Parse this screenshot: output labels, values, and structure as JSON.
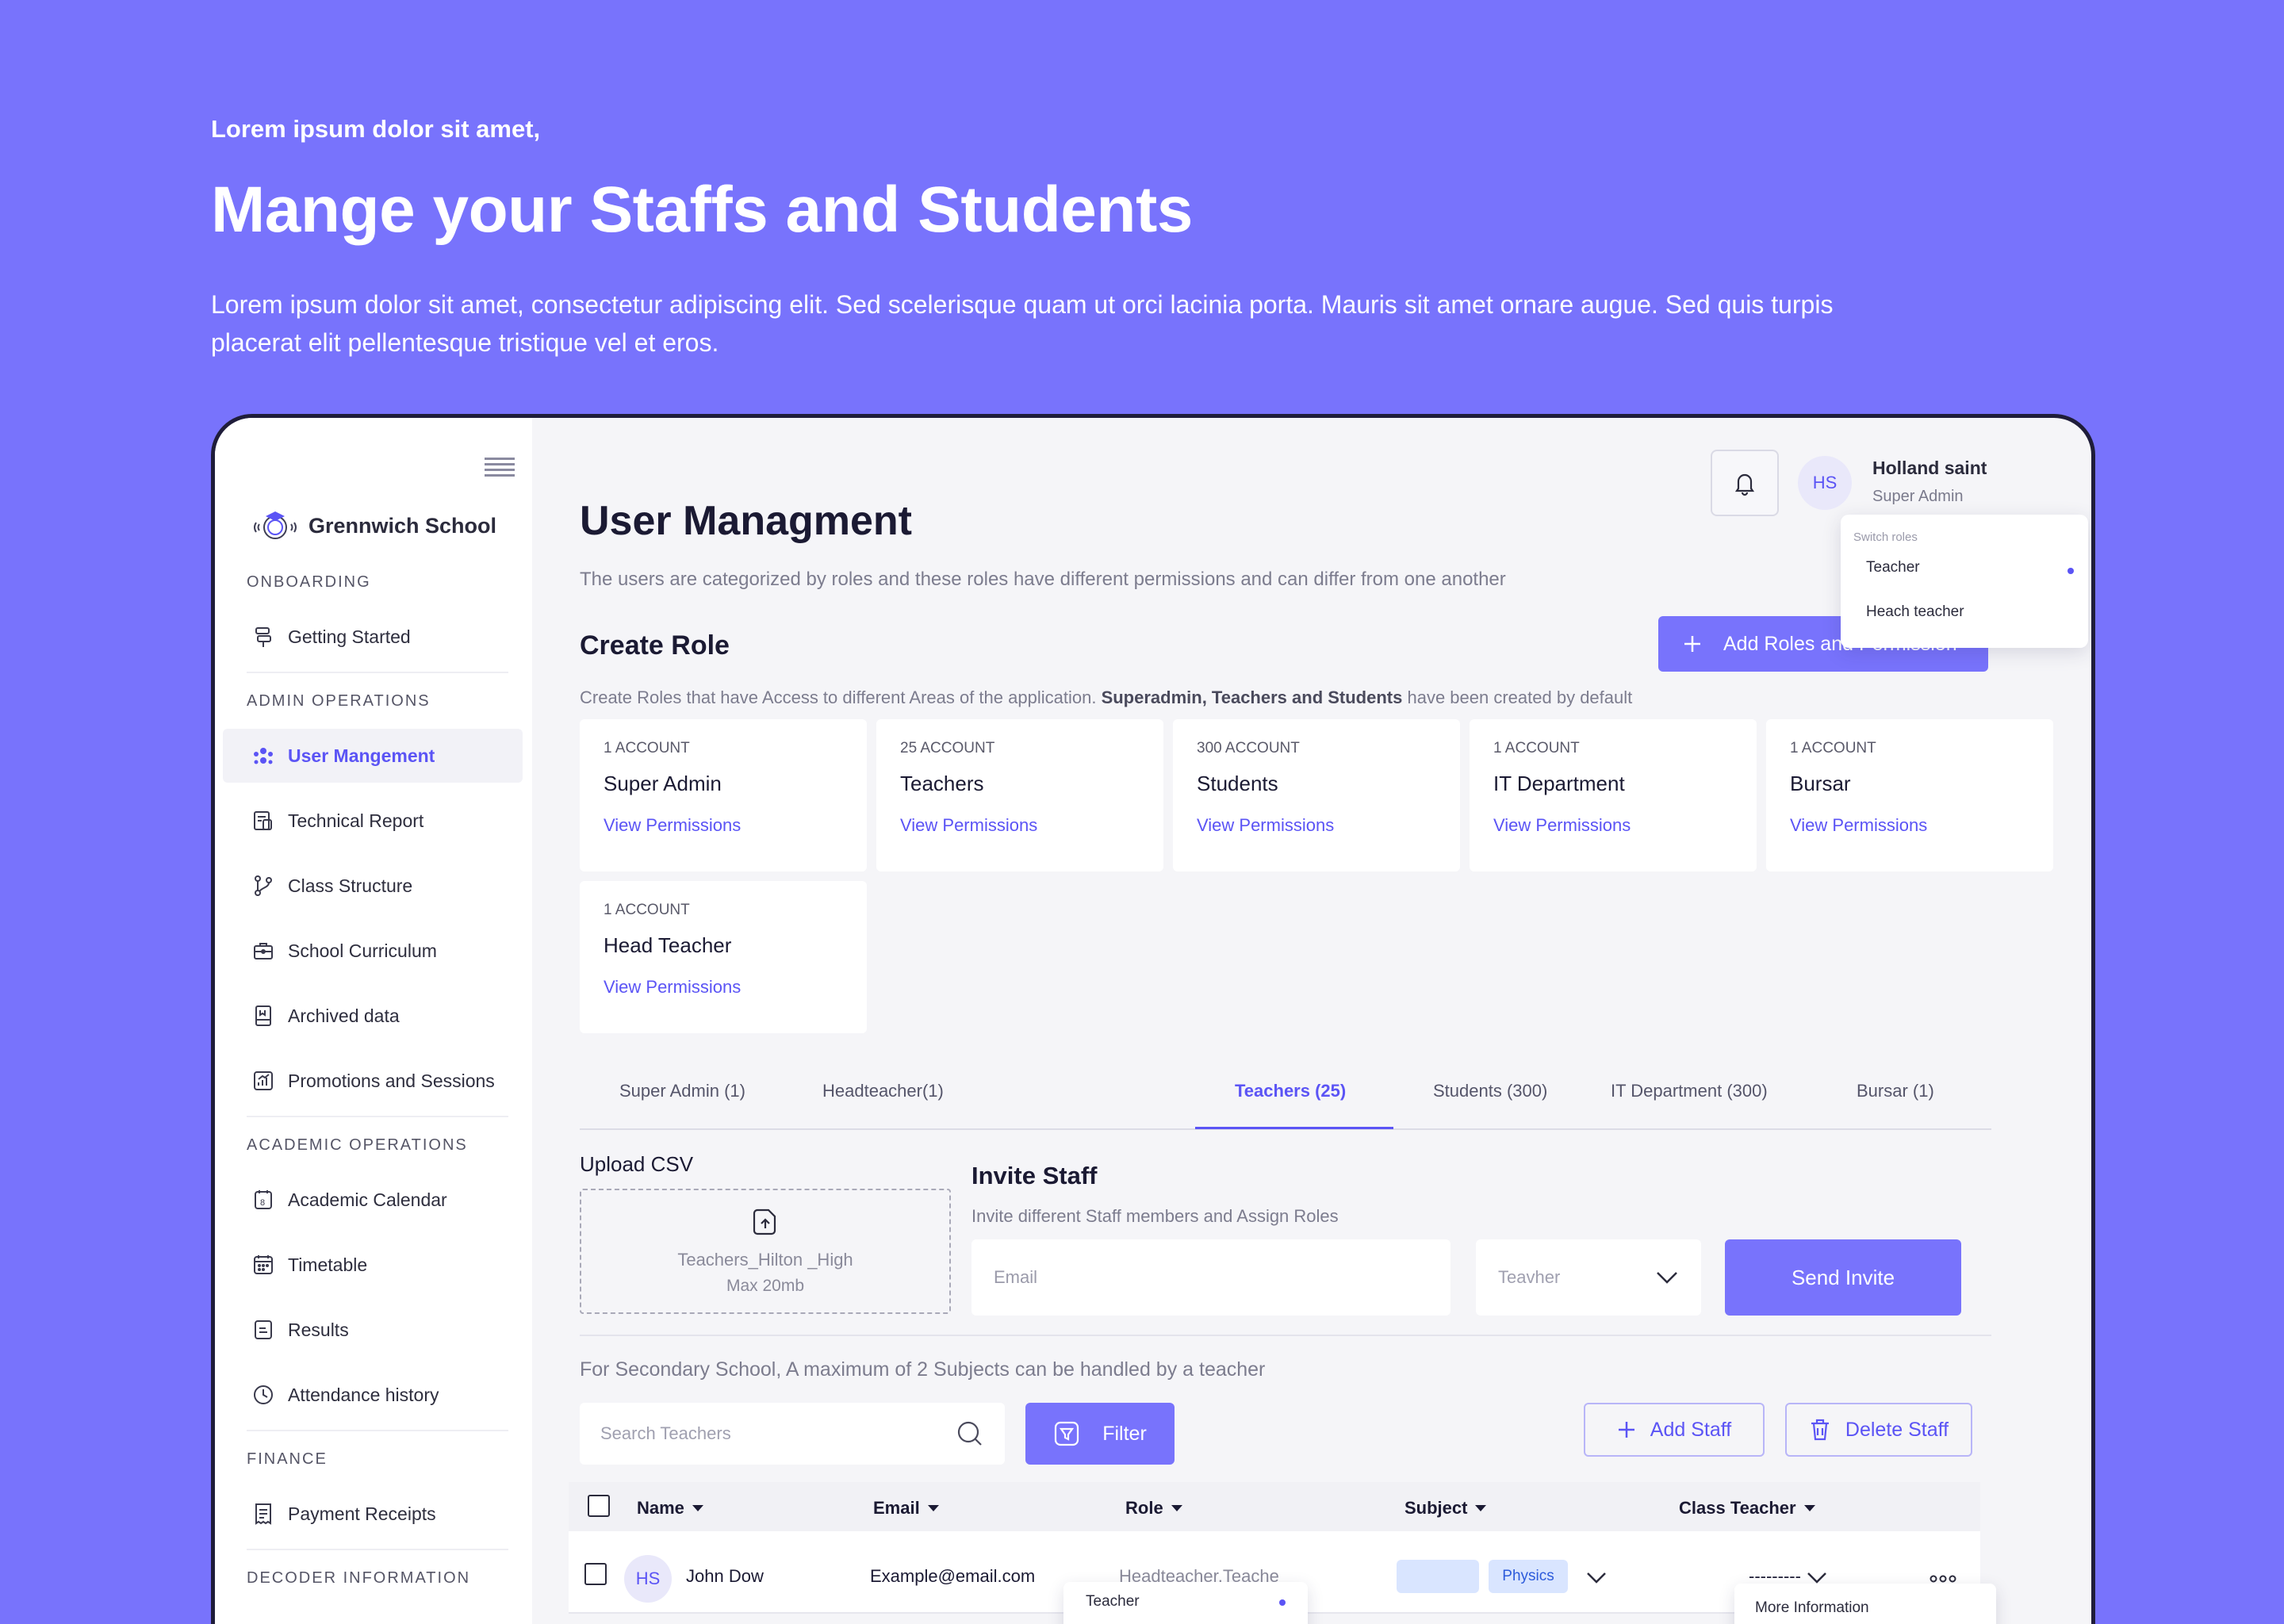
{
  "hero": {
    "eyebrow": "Lorem ipsum dolor sit amet,",
    "title": "Mange your Staffs and Students",
    "description": "Lorem ipsum dolor sit amet, consectetur adipiscing elit. Sed scelerisque quam ut orci lacinia porta. Mauris sit amet ornare augue. Sed quis turpis placerat elit pellentesque tristique vel et eros."
  },
  "colors": {
    "background": "#7873FC",
    "accent": "#5B54F5",
    "panel": "#F5F5F8"
  },
  "sidebar": {
    "brand": "Grennwich School",
    "sections": {
      "onboarding": "ONBOARDING",
      "admin": "ADMIN OPERATIONS",
      "academic": "ACADEMIC OPERATIONS",
      "finance": "FINANCE",
      "decoder": "DECODER INFORMATION"
    },
    "items": {
      "getting_started": "Getting Started",
      "user_management": "User Mangement",
      "technical_report": "Technical Report",
      "class_structure": "Class Structure",
      "school_curriculum": "School Curriculum",
      "archived_data": "Archived data",
      "promotions": "Promotions and Sessions",
      "academic_calendar": "Academic Calendar",
      "timetable": "Timetable",
      "results": "Results",
      "attendance": "Attendance history",
      "payment_receipts": "Payment Receipts"
    }
  },
  "header": {
    "avatar_initials": "HS",
    "user_name": "Holland saint",
    "user_role": "Super Admin",
    "switch_roles": {
      "label": "Switch roles",
      "options": [
        "Teacher",
        "Heach teacher"
      ],
      "selected": "Teacher"
    }
  },
  "page": {
    "title": "User Managment",
    "subtitle": "The users are categorized by roles and these roles have different permissions and can differ from one another"
  },
  "create_role": {
    "title": "Create Role",
    "add_button": "Add Roles  and Permission",
    "note_prefix": "Create Roles that have Access to different Areas of the application.",
    "note_bold": "Superadmin, Teachers  and Students",
    "note_suffix": "have been created by default",
    "cards": [
      {
        "count": "1 ACCOUNT",
        "name": "Super Admin",
        "link": "View Permissions"
      },
      {
        "count": "25 ACCOUNT",
        "name": "Teachers",
        "link": "View Permissions"
      },
      {
        "count": "300 ACCOUNT",
        "name": "Students",
        "link": "View Permissions"
      },
      {
        "count": "1 ACCOUNT",
        "name": "IT Department",
        "link": "View Permissions"
      },
      {
        "count": "1 ACCOUNT",
        "name": "Bursar",
        "link": "View Permissions"
      },
      {
        "count": "1 ACCOUNT",
        "name": "Head Teacher",
        "link": "View Permissions"
      }
    ]
  },
  "tabs": [
    "Super Admin (1)",
    "Headteacher(1)",
    "Teachers (25)",
    "Students  (300)",
    "IT Department (300)",
    "Bursar (1)"
  ],
  "upload": {
    "label": "Upload CSV",
    "file_name": "Teachers_Hilton _High",
    "max_size": "Max 20mb"
  },
  "invite": {
    "title": "Invite Staff",
    "subtitle": "Invite different Staff members  and Assign Roles",
    "email_placeholder": "Email",
    "role_value": "Teavher",
    "send_label": "Send Invite"
  },
  "staff": {
    "note": "For Secondary School, A maximum of 2 Subjects  can be handled by a teacher",
    "search_placeholder": "Search Teachers",
    "filter_label": "Filter",
    "add_label": "Add Staff",
    "delete_label": "Delete Staff"
  },
  "table": {
    "headers": [
      "Name",
      "Email",
      "Role",
      "Subject",
      "Class Teacher"
    ],
    "rows": [
      {
        "initials": "HS",
        "name": "John Dow",
        "email": "Example@email.com",
        "role": "Headteacher,Teache",
        "subjects": [
          "",
          "Physics"
        ],
        "class_teacher": "---------"
      }
    ],
    "role_popup": "Teacher",
    "more_popup": "More Information"
  }
}
